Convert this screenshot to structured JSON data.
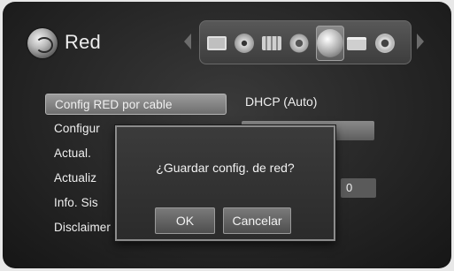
{
  "header": {
    "title": "Red",
    "logo_icon": "globe-network-icon",
    "category_icons": [
      "tv-icon",
      "disc-icon",
      "film-icon",
      "gears-icon",
      "globe-network-icon",
      "folder-icon",
      "settings-cog-icon"
    ],
    "selected_category": "globe-network-icon"
  },
  "menu": {
    "items": [
      {
        "label": "Config RED por cable",
        "active": true
      },
      {
        "label": "Configur",
        "active": false
      },
      {
        "label": "Actual.",
        "active": false
      },
      {
        "label": "Actualiz",
        "active": false
      },
      {
        "label": "Info. Sis",
        "active": false
      },
      {
        "label": "Disclaimer Notice",
        "active": false
      }
    ]
  },
  "detail": {
    "mode_label": "DHCP (Auto)",
    "ip_value": "0"
  },
  "dialog": {
    "message": "¿Guardar config. de red?",
    "ok_label": "OK",
    "cancel_label": "Cancelar"
  }
}
